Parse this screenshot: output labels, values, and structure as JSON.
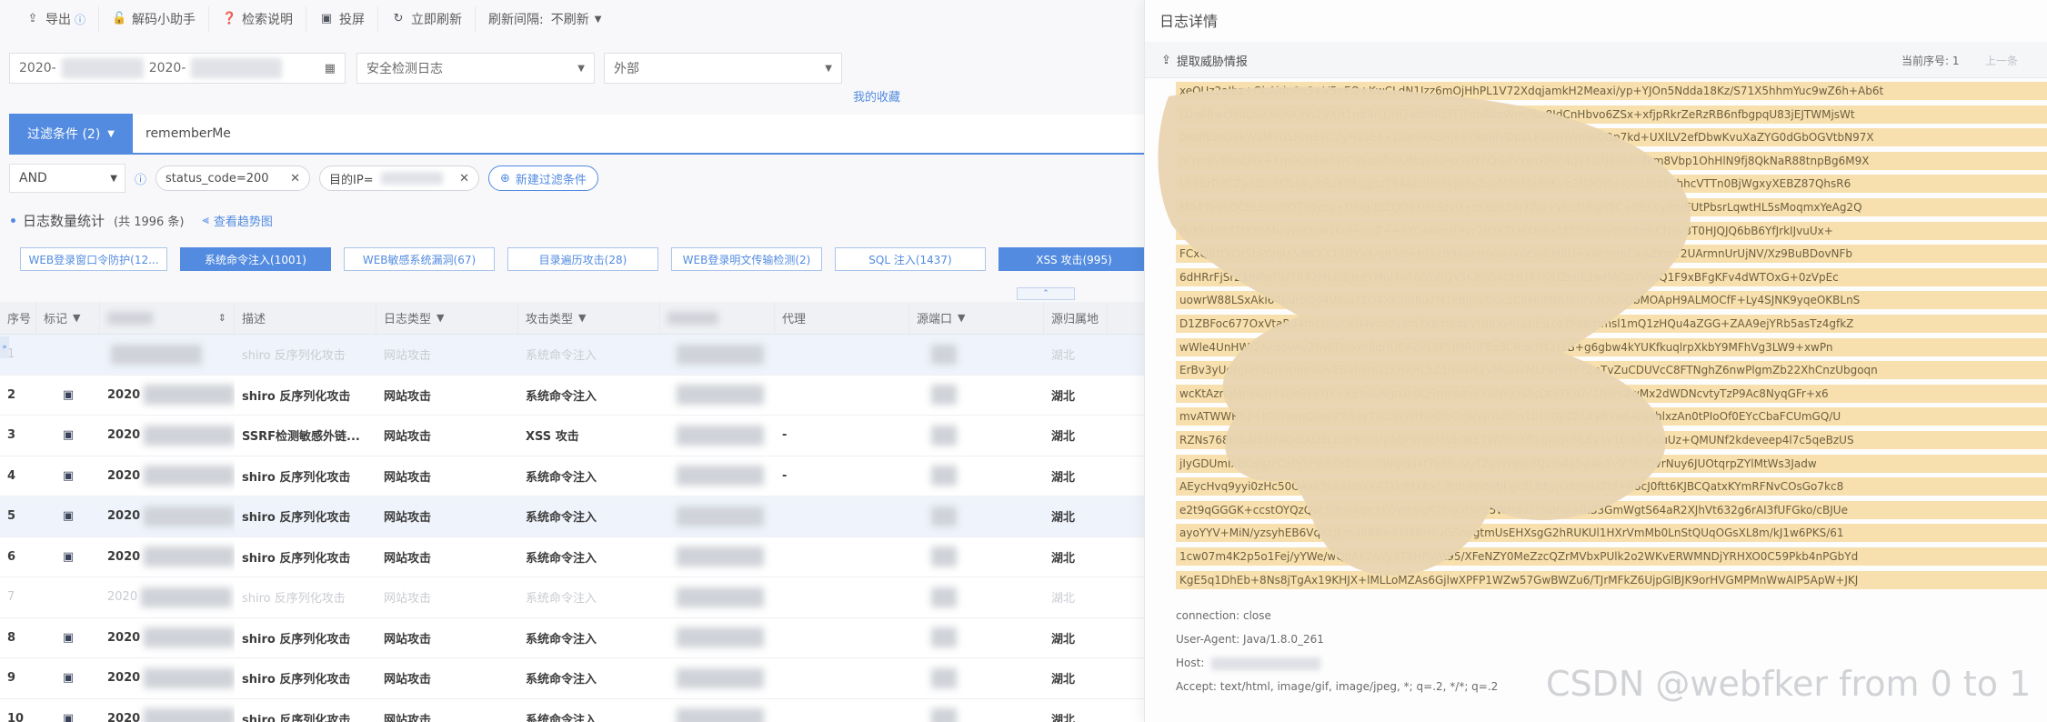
{
  "toolbar": {
    "export": "导出",
    "decode": "解码小助手",
    "search_help": "检索说明",
    "screen": "投屏",
    "refresh_now": "立即刷新",
    "refresh_interval_label": "刷新间隔:",
    "refresh_interval_value": "不刷新"
  },
  "filters": {
    "date_start": "2020-",
    "date_end": "2020-",
    "log_source": "安全检测日志",
    "direction": "外部",
    "favorites_link": "我的收藏"
  },
  "condition": {
    "button_label": "过滤条件 (2)",
    "query_text": "rememberMe",
    "logic": "AND",
    "chips": [
      "status_code=200",
      "目的IP="
    ],
    "add_label": "新建过滤条件"
  },
  "stats": {
    "title": "日志数量统计",
    "count": "(共 1996 条)",
    "trend_link": "查看趋势图"
  },
  "tags": [
    {
      "label": "WEB登录窗口令防护(12...",
      "active": false,
      "w": 162
    },
    {
      "label": "系统命令注入(1001)",
      "active": true,
      "w": 166
    },
    {
      "label": "WEB敏感系统漏洞(67)",
      "active": false,
      "w": 166
    },
    {
      "label": "目录遍历攻击(28)",
      "active": false,
      "w": 166
    },
    {
      "label": "WEB登录明文传输检测(2)",
      "active": false,
      "w": 166
    },
    {
      "label": "SQL 注入(1437)",
      "active": false,
      "w": 166
    },
    {
      "label": "XSS 攻击(995)",
      "active": true,
      "w": 166
    }
  ],
  "table": {
    "headers": [
      "序号",
      "标记",
      "",
      "描述",
      "日志类型",
      "攻击类型",
      "",
      "代理",
      "源端口",
      "源归属地"
    ],
    "rows": [
      {
        "idx": "1",
        "time": "",
        "desc": "shiro 反序列化攻击",
        "logtype": "网站攻击",
        "attack": "系统命令注入",
        "proxy": "",
        "region": "湖北",
        "dim": true,
        "selected": true
      },
      {
        "idx": "2",
        "time": "2020",
        "desc": "shiro 反序列化攻击",
        "logtype": "网站攻击",
        "attack": "系统命令注入",
        "proxy": "",
        "region": "湖北",
        "dim": false,
        "selected": false
      },
      {
        "idx": "3",
        "time": "2020",
        "desc": "SSRF检测敏感外链...",
        "logtype": "网站攻击",
        "attack": "XSS 攻击",
        "proxy": "-",
        "region": "湖北",
        "dim": false,
        "selected": false
      },
      {
        "idx": "4",
        "time": "2020",
        "desc": "shiro 反序列化攻击",
        "logtype": "网站攻击",
        "attack": "系统命令注入",
        "proxy": "-",
        "region": "湖北",
        "dim": false,
        "selected": false
      },
      {
        "idx": "5",
        "time": "2020",
        "desc": "shiro 反序列化攻击",
        "logtype": "网站攻击",
        "attack": "系统命令注入",
        "proxy": "",
        "region": "湖北",
        "dim": false,
        "selected": true
      },
      {
        "idx": "6",
        "time": "2020",
        "desc": "shiro 反序列化攻击",
        "logtype": "网站攻击",
        "attack": "系统命令注入",
        "proxy": "",
        "region": "湖北",
        "dim": false,
        "selected": false
      },
      {
        "idx": "7",
        "time": "2020",
        "desc": "shiro 反序列化攻击",
        "logtype": "网站攻击",
        "attack": "系统命令注入",
        "proxy": "",
        "region": "湖北",
        "dim": true,
        "selected": false
      },
      {
        "idx": "8",
        "time": "2020",
        "desc": "shiro 反序列化攻击",
        "logtype": "网站攻击",
        "attack": "系统命令注入",
        "proxy": "",
        "region": "湖北",
        "dim": false,
        "selected": false
      },
      {
        "idx": "9",
        "time": "2020",
        "desc": "shiro 反序列化攻击",
        "logtype": "网站攻击",
        "attack": "系统命令注入",
        "proxy": "",
        "region": "湖北",
        "dim": false,
        "selected": false
      },
      {
        "idx": "10",
        "time": "2020",
        "desc": "shiro 反序列化攻击",
        "logtype": "网站攻击",
        "attack": "系统命令注入",
        "proxy": "",
        "region": "湖北",
        "dim": false,
        "selected": false
      }
    ]
  },
  "detail": {
    "title": "日志详情",
    "extract": "提取威胁情报",
    "seq": "当前序号: 1",
    "prev": "上一条",
    "cookie_lines": [
      "xeOUz2aIbz+GbAjdo6nS+V5nEQ+KwCLdN1Izz6mOjHhPL1V72XdqjamkH2Meaxi/yp+YJOn5Ndda18Kz/S71X5hhmYuc9wZ6h+Ab6t",
      "LUq6RwcMuDSXMD0Unh1VXH1mt9n1jHi7adNlRt7Ti7dhRxaWmJTsu8IdCnHbvo6ZSx+xfjpRkrZeRzRB6nfbgpqU83jEJTWMjsWt",
      "bwdfBmD9kWaMYUSRrh5vOZyHaaE6+Lzie9xKBHJ6EY8bplVDp2LPuaWjWmeQQp7kd+UXlLV2efDbwKvuXaZYG0dGbOGVtbN97X",
      "mYm8vBbaD9k+Xm9Oo8whv/CuSqHfHsUMqeTuHpSsfFhQGdVxwrRRlc4gV5u3J0oaHMkm8Vbp1OhHlN9fj8QkNaR88tnpBg6M9X",
      "Lh6BrDXCZwUBs3KfLbkyRRu8fMqgjszT94ALuU68kpJPxZuaM5kMe3dKvh2N0GYt+kxsLmzBvhhcVTTn0BjWgxyXEBZ87QhsR6",
      "M04Ybk9DCbLbouDOTY0yzq+D8Ig/EJZQO8xHsSzyU+zKqbk3Aj77Ju+VLuMRqH5C+PSxXyRmEUtPbsrLqwtHL5sMoqmxYeAg2Q",
      "RyKEd/I8RTbQfM4uvWiQqw1KuI+unZ++SYCwNmH+zr2rQXZLHXPl6xqEC5bpdyb5hEnlsCN9v3T0HJQJQ6bB6YfJrkIJvuUx+",
      "FCxQBtQIOrShP0JgUiVNKXX17UYvX/qp3J8+hfAxB9WqaHv6bjxWSoRM8U+xWi9HnEwAZzmY2UArmnUrUjNV/Xz9BuBDovNFb",
      "6dHRrFjSrZ1hiPoTIU7R72MLG2jtutYMol7nT6BYdIQY5KXhGxc1rU7TKlUZlnIE1wHAObTVmQ1F9xBFgKFv4dWTOxG+0zVpEc",
      "uowrW88LSxAkl64pur6Qg4Uhuj72Q4Xk3nfRu7MTkBjJhzGUczC9k6iMRU6HlV3OGkObMOApH9ALMOCfF+Ly4SJNK9yqeOKBLnS",
      "D1ZBFoc677OxVtaRd4rhtszJvC6B4ymlXj3m7x8mhdpVHJdXv8LLhEu7q7F98mmsl1mQ1zHQu4aZGG+ZAA9ejYRb5asTz4gfkZ",
      "wWle4UnHW/2AxapvAvZhWTU/xm0grlUE4Zy13FYlMR0FEa3CRqkfW2r1B+g6gbw4kYUKfkuqlrpXkbY9MFhVg3LW9+xwPn",
      "ErBv3yUdrgkH9DH9pfmSDvEBqh8qG1xHXHL5Z1hV4M2VMGDvMLFuH6tPTZaTvZuCDUVcC8FTNghZ6nwPlgmZb22XhCnzUbgoqn",
      "wcKtAznqMr+IOYt4UrGlJ6YJY+XEbuLNgtDb0Q5rqnbzv6YWWJcNAcDt8TKd7c1fi9rs2wMx2dWDNcvtyTzP9Ac8NyqGFr+x6",
      "mvATWWRh2+IOZHwuQsxsVTr5xyT6d3JrWHvXObOrJNVjGuEOn1b1cDjrZhULyBvw6AnjqhlxzAn0tPIoOf0EYcCbaFCUmGQ/U",
      "RZNs768mbAIENPAQdlAD5LkoJHmuUy4QFW3EMVb0KETWZ0nX01gwQU9L6y1v1OlKhDuuUz+QMUNf2kdeveep4l7c5qeBzUS",
      "jIyGDUmIxECqqzFCxPrYF9/6OrDkrm0Wgkjd4f7pF6uVuTZpWPpIs0Q2jn4JJ5w4kXvV73xOvrNuy6JUOtqrpZYlMtWs3Jadw",
      "AEycHvq9yyi0zHc50OAxx3nkAb6xX4Txk/MXbx13HB4W8MJLgc3LB6y/LdHmUZfd+R8cJ0ftt6KJBCQatxKYmRFNvCOsGo7kc8",
      "e2t9qGGGK+ccstOYQzQvLS8hn8gn3XQWbpgK1bqGfSvB5WHdv2I3I0nWkRi33GmWgtS64aR2XJhVt632g6rAI3fUFGko/cBJUe",
      "ayoYYV+MiN/yzsyhEB6VqXcJL/nd9RRw6M9BH6vG5rwgtmUsEHXsgG2hRUKUl1HXrVmMb0LnStQUqOGsXL8m/kJ1w6PKS/61",
      "1cw07m4K2p5o1Fej/yYWe/wQnAk2Ai/y3T9HRVAt95/XFeNZY0MeZzcQZrMVbxPUlk2o2WKvERWMNDjYRHXO0C59Pkb4nPGbYd",
      "KgE5q1DhEb+8Ns8jTgAx19KHJX+lMLLoMZAs6GjlwXPFP1WZw57GwBWZu6/TJrMFkZ6UjpGlBJK9orHVGMPMnWwAIP5ApW+JKJ"
    ],
    "connection": "connection: close",
    "user_agent": "User-Agent: Java/1.8.0_261",
    "host": "Host:",
    "accept": "Accept: text/html, image/gif, image/jpeg, *; q=.2, */*; q=.2"
  },
  "watermark": "CSDN @webfker from 0 to 1",
  "colors": {
    "accent": "#3b7bdc",
    "highlight": "#f6dca2",
    "mask": "#e6cfa8"
  }
}
